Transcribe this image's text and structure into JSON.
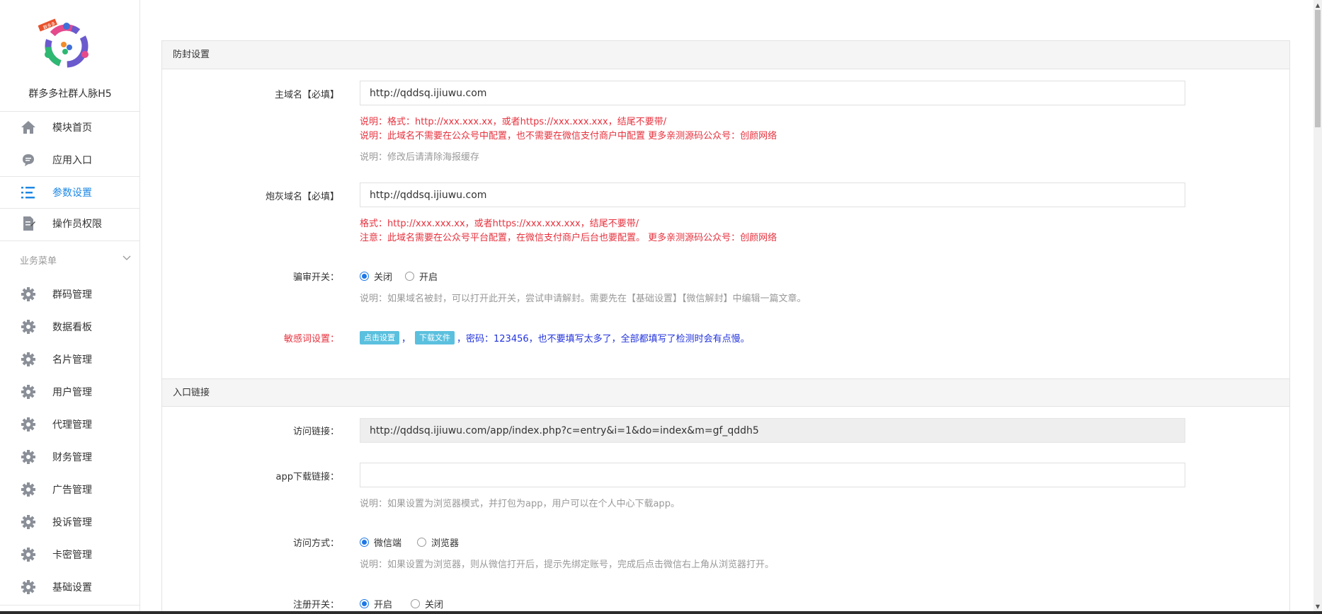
{
  "sidebar": {
    "site_name": "群多多社群人脉H5",
    "top_items": [
      {
        "label": "模块首页",
        "icon": "home-icon"
      },
      {
        "label": "应用入口",
        "icon": "chat-bubble-icon"
      },
      {
        "label": "参数设置",
        "icon": "list-settings-icon",
        "active": true
      },
      {
        "label": "操作员权限",
        "icon": "document-edit-icon"
      }
    ],
    "section_title": "业务菜单",
    "business_items": [
      {
        "label": "群码管理",
        "icon": "gear-icon"
      },
      {
        "label": "数据看板",
        "icon": "gear-icon"
      },
      {
        "label": "名片管理",
        "icon": "gear-icon"
      },
      {
        "label": "用户管理",
        "icon": "gear-icon"
      },
      {
        "label": "代理管理",
        "icon": "gear-icon"
      },
      {
        "label": "财务管理",
        "icon": "gear-icon"
      },
      {
        "label": "广告管理",
        "icon": "gear-icon"
      },
      {
        "label": "投诉管理",
        "icon": "gear-icon"
      },
      {
        "label": "卡密管理",
        "icon": "gear-icon"
      },
      {
        "label": "基础设置",
        "icon": "gear-icon"
      }
    ],
    "badge_text": "群多多"
  },
  "anti_block": {
    "title": "防封设置",
    "main_domain_label": "主域名【必填】",
    "main_domain_value": "http://qddsq.ijiuwu.com",
    "main_domain_hint1": "说明：格式：http://xxx.xxx.xx，或者https://xxx.xxx.xxx，结尾不要带/",
    "main_domain_hint2": "说明：此域名不需要在公众号中配置，也不需要在微信支付商户中配置 更多亲测源码公众号：创颜网络",
    "main_domain_hint3": "说明：修改后请清除海报缓存",
    "cannon_domain_label": "炮灰域名【必填】",
    "cannon_domain_value": "http://qddsq.ijiuwu.com",
    "cannon_domain_hint1": "格式：http://xxx.xxx.xx，或者https://xxx.xxx.xxx，结尾不要带/",
    "cannon_domain_hint2": "注意：此域名需要在公众号平台配置，在微信支付商户后台也要配置。 更多亲测源码公众号：创颜网络",
    "review_label": "骗审开关：",
    "review_options": [
      "关闭",
      "开启"
    ],
    "review_selected": "关闭",
    "review_hint": "说明：如果域名被封，可以打开此开关，尝试申请解封。需要先在【基础设置】【微信解封】中编辑一篇文章。",
    "sensitive_label": "敏感词设置：",
    "sensitive_btn1": "点击设置",
    "sensitive_sep": "，",
    "sensitive_btn2": "下载文件",
    "sensitive_text": "，密码：123456，也不要填写太多了，全部都填写了检测时会有点慢。"
  },
  "entry": {
    "title": "入口链接",
    "visit_label": "访问链接：",
    "visit_value": "http://qddsq.ijiuwu.com/app/index.php?c=entry&i=1&do=index&m=gf_qddh5",
    "app_label": "app下载链接：",
    "app_value": "",
    "app_hint": "说明：如果设置为浏览器模式，并打包为app，用户可以在个人中心下载app。",
    "mode_label": "访问方式：",
    "mode_options": [
      "微信端",
      "浏览器"
    ],
    "mode_selected": "微信端",
    "mode_hint": "说明：如果设置为浏览器，则从微信打开后，提示先绑定账号，完成后点击微信右上角从浏览器打开。",
    "register_label": "注册开关：",
    "register_options": [
      "开启",
      "关闭"
    ],
    "register_selected": "开启"
  },
  "colors": {
    "accent": "#1e88e5",
    "hint_red": "#e6323e",
    "hint_blue": "#2233dd",
    "tag_bg": "#5bc0de"
  }
}
